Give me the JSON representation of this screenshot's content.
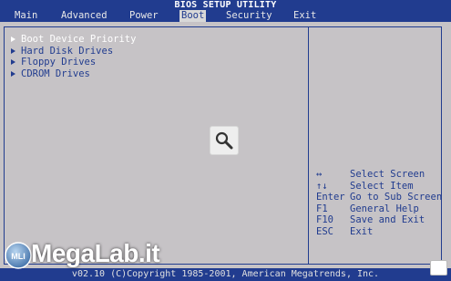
{
  "header": {
    "title": "BIOS SETUP UTILITY",
    "menu": [
      {
        "label": "Main",
        "active": false
      },
      {
        "label": "Advanced",
        "active": false
      },
      {
        "label": "Power",
        "active": false
      },
      {
        "label": "Boot",
        "active": true
      },
      {
        "label": "Security",
        "active": false
      },
      {
        "label": "Exit",
        "active": false
      }
    ]
  },
  "boot_menu": {
    "items": [
      {
        "label": "Boot Device Priority",
        "selected": true
      },
      {
        "label": "Hard Disk Drives",
        "selected": false
      },
      {
        "label": "Floppy Drives",
        "selected": false
      },
      {
        "label": "CDROM Drives",
        "selected": false
      }
    ]
  },
  "help": [
    {
      "key": "↔",
      "desc": "Select Screen"
    },
    {
      "key": "↑↓",
      "desc": "Select Item"
    },
    {
      "key": "Enter",
      "desc": "Go to Sub Screen"
    },
    {
      "key": "F1",
      "desc": "General Help"
    },
    {
      "key": "F10",
      "desc": "Save and Exit"
    },
    {
      "key": "ESC",
      "desc": "Exit"
    }
  ],
  "footer": {
    "text": "v02.10 (C)Copyright 1985-2001, American Megatrends, Inc."
  },
  "watermark": {
    "text": "MegaLab.it",
    "logo_text": "MLI"
  },
  "icons": {
    "zoom": "magnifier-icon",
    "selector": "triangle-right-icon"
  },
  "colors": {
    "bios_blue": "#213c8f",
    "bios_gray": "#c6c3c6",
    "highlight": "#ffffff"
  }
}
